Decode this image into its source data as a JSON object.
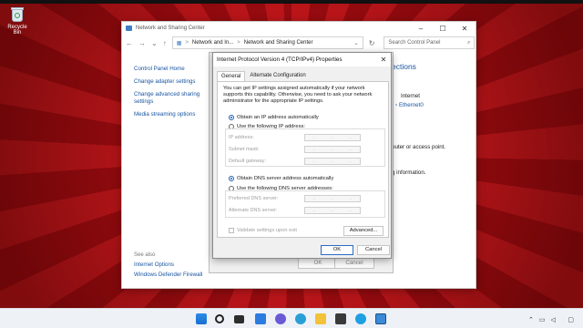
{
  "desktop": {
    "recycle_bin_label": "Recycle Bin"
  },
  "window": {
    "title": "Network and Sharing Center",
    "address": {
      "crumb1": "Network and In...",
      "separator": ">",
      "crumb2": "Network and Sharing Center"
    },
    "search_placeholder": "Search Control Panel",
    "left_links": [
      "Control Panel Home",
      "Change adapter settings",
      "Change advanced sharing settings",
      "Media streaming options"
    ],
    "see_also_label": "See also",
    "see_also_links": [
      "Internet Options",
      "Windows Defender Firewall"
    ],
    "right_fragments": {
      "heading": "ections",
      "internet": "Internet",
      "ethernet": "Ethernet0",
      "router": "outer or access point.",
      "info": "g information."
    }
  },
  "back_dialog": {
    "ok_label": "OK",
    "cancel_label": "Cancel"
  },
  "dialog": {
    "title": "Internet Protocol Version 4 (TCP/IPv4) Properties",
    "close": "✕",
    "tabs": [
      "General",
      "Alternate Configuration"
    ],
    "description": "You can get IP settings assigned automatically if your network supports this capability. Otherwise, you need to ask your network administrator for the appropriate IP settings.",
    "ip_auto": "Obtain an IP address automatically",
    "ip_manual": "Use the following IP address:",
    "ip_fields": [
      "IP address:",
      "Subnet mask:",
      "Default gateway:"
    ],
    "dns_auto": "Obtain DNS server address automatically",
    "dns_manual": "Use the following DNS server addresses:",
    "dns_fields": [
      "Preferred DNS server:",
      "Alternate DNS server:"
    ],
    "validate": "Validate settings upon exit",
    "advanced": "Advanced...",
    "ok": "OK",
    "cancel": "Cancel",
    "ip_dot": ".",
    "selected_ip_option": "automatic",
    "selected_dns_option": "automatic"
  },
  "colors": {
    "accent": "#1a5fb4",
    "link": "#1a55a0",
    "desktop_red": "#c0141a"
  },
  "taskbar": {
    "icons": [
      "windows-start-icon",
      "search-icon",
      "task-view-icon",
      "widgets-icon",
      "chat-icon",
      "edge-icon",
      "file-explorer-icon",
      "store-icon",
      "skype-icon",
      "control-panel-icon"
    ]
  }
}
